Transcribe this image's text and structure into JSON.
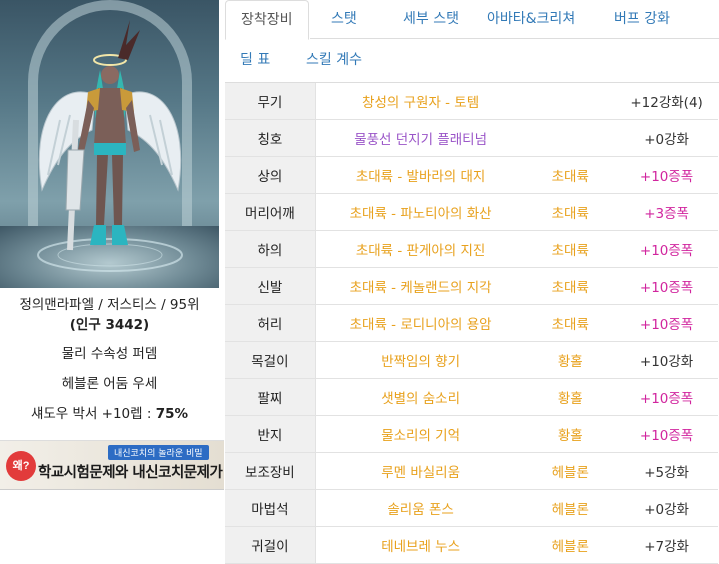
{
  "character": {
    "name_line": "정의맨라파엘 / 저스티스 / 95위",
    "popularity": "(인구 3442)",
    "buff_line_1": "물리 수속성 퍼뎀",
    "buff_line_2": "헤블론 어둠 우세",
    "buff_line_3_label": "섀도우 박서 +10렙 : ",
    "buff_line_3_value": "75%"
  },
  "ad": {
    "mark_text": "왜?",
    "badge_text": "내신코치의 놀라운 비밀",
    "headline": "학교시험문제와 내신코치문제가"
  },
  "tabs": {
    "row1": [
      "장착장비",
      "스탯",
      "세부 스탯",
      "아바타&크리쳐",
      "버프 강화"
    ],
    "row2": [
      "딜 표",
      "스킬 계수"
    ],
    "active": "장착장비"
  },
  "colors": {
    "epic_orange": "#e8a11d",
    "rare_purple": "#9a55c8",
    "amp_magenta": "#d1259e",
    "tab_blue": "#337ab7"
  },
  "equipment": [
    {
      "slot": "무기",
      "name": "창성의 구원자 - 토템",
      "set": "",
      "enh": "+12강화(4)",
      "name_color": "epic_orange",
      "enh_color": "plain"
    },
    {
      "slot": "칭호",
      "name": "물풍선 던지기 플래티넘",
      "set": "",
      "enh": "+0강화",
      "name_color": "rare_purple",
      "enh_color": "plain"
    },
    {
      "slot": "상의",
      "name": "초대륙 - 발바라의 대지",
      "set": "초대륙",
      "enh": "+10증폭",
      "name_color": "epic_orange",
      "enh_color": "magenta"
    },
    {
      "slot": "머리어깨",
      "name": "초대륙 - 파노티아의 화산",
      "set": "초대륙",
      "enh": "+3증폭",
      "name_color": "epic_orange",
      "enh_color": "magenta"
    },
    {
      "slot": "하의",
      "name": "초대륙 - 판게아의 지진",
      "set": "초대륙",
      "enh": "+10증폭",
      "name_color": "epic_orange",
      "enh_color": "magenta"
    },
    {
      "slot": "신발",
      "name": "초대륙 - 케놀랜드의 지각",
      "set": "초대륙",
      "enh": "+10증폭",
      "name_color": "epic_orange",
      "enh_color": "magenta"
    },
    {
      "slot": "허리",
      "name": "초대륙 - 로디니아의 용암",
      "set": "초대륙",
      "enh": "+10증폭",
      "name_color": "epic_orange",
      "enh_color": "magenta"
    },
    {
      "slot": "목걸이",
      "name": "반짝임의 향기",
      "set": "황홀",
      "enh": "+10강화",
      "name_color": "epic_orange",
      "enh_color": "plain"
    },
    {
      "slot": "팔찌",
      "name": "샛별의 숨소리",
      "set": "황홀",
      "enh": "+10증폭",
      "name_color": "epic_orange",
      "enh_color": "magenta"
    },
    {
      "slot": "반지",
      "name": "물소리의 기억",
      "set": "황홀",
      "enh": "+10증폭",
      "name_color": "epic_orange",
      "enh_color": "magenta"
    },
    {
      "slot": "보조장비",
      "name": "루멘 바실리움",
      "set": "헤블론",
      "enh": "+5강화",
      "name_color": "epic_orange",
      "enh_color": "plain"
    },
    {
      "slot": "마법석",
      "name": "솔리움 폰스",
      "set": "헤블론",
      "enh": "+0강화",
      "name_color": "epic_orange",
      "enh_color": "plain"
    },
    {
      "slot": "귀걸이",
      "name": "테네브레 누스",
      "set": "헤블론",
      "enh": "+7강화",
      "name_color": "epic_orange",
      "enh_color": "plain"
    }
  ]
}
